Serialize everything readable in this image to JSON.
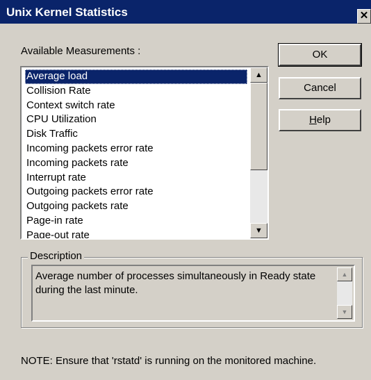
{
  "window": {
    "title": "Unix Kernel Statistics",
    "close_glyph": "✕"
  },
  "measurements": {
    "label": "Available Measurements :",
    "items": [
      "Average load",
      "Collision Rate",
      "Context switch rate",
      "CPU Utilization",
      "Disk Traffic",
      "Incoming packets error rate",
      "Incoming packets rate",
      "Interrupt rate",
      "Outgoing packets error rate",
      "Outgoing packets rate",
      "Page-in rate",
      "Page-out rate"
    ],
    "selected_index": 0
  },
  "buttons": {
    "ok": "OK",
    "cancel": "Cancel",
    "help_prefix": "H",
    "help_rest": "elp"
  },
  "description": {
    "label": "Description",
    "text": "Average number of processes simultaneously in Ready state during the last minute."
  },
  "note": "NOTE: Ensure that 'rstatd' is running on the monitored machine.",
  "colors": {
    "titlebar": "#0a246a",
    "dialog_bg": "#d4d0c8",
    "selection": "#0a246a"
  }
}
